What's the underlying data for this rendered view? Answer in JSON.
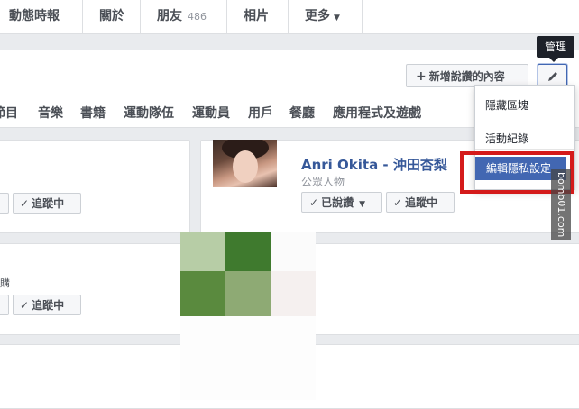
{
  "tabs": [
    {
      "label": "動態時報"
    },
    {
      "label": "關於"
    },
    {
      "label": "朋友",
      "count": "486"
    },
    {
      "label": "相片"
    },
    {
      "label": "更多",
      "caret": "▼"
    }
  ],
  "tooltip": "管理",
  "add_like_button": {
    "icon": "+",
    "label": "新增說讚的內容"
  },
  "categories": [
    "節目",
    "音樂",
    "書籍",
    "運動隊伍",
    "運動員",
    "用戶",
    "餐廳",
    "應用程式及遊戲"
  ],
  "cards": {
    "follow_label": "追蹤中",
    "liked_label": "已說讚",
    "left_text": "購",
    "featured_page": {
      "name": "Anri Okita - 沖田杏梨",
      "category": "公眾人物"
    }
  },
  "menu": {
    "items": [
      "隱藏區塊",
      "活動紀錄",
      "編輯隱私設定"
    ]
  },
  "watermark": "bomb01.com",
  "icons": {
    "check": "check-icon",
    "pencil": "pencil-icon",
    "caret": "caret-down-icon"
  }
}
